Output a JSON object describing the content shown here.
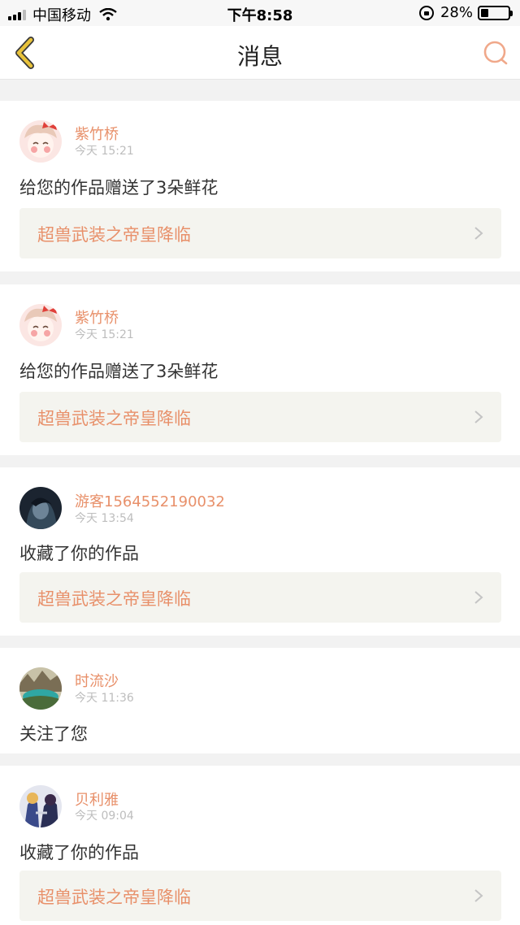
{
  "status_bar": {
    "carrier": "中国移动",
    "time": "下午8:58",
    "battery": "28%"
  },
  "header": {
    "title": "消息"
  },
  "messages": [
    {
      "user": "紫竹桥",
      "time": "今天 15:21",
      "text": "给您的作品赠送了3朵鲜花",
      "work": "超兽武装之帝皇降临"
    },
    {
      "user": "紫竹桥",
      "time": "今天 15:21",
      "text": "给您的作品赠送了3朵鲜花",
      "work": "超兽武装之帝皇降临"
    },
    {
      "user": "游客1564552190032",
      "time": "今天 13:54",
      "text": "收藏了你的作品",
      "work": "超兽武装之帝皇降临"
    },
    {
      "user": "时流沙",
      "time": "今天 11:36",
      "text": "关注了您"
    },
    {
      "user": "贝利雅",
      "time": "今天 09:04",
      "text": "收藏了你的作品",
      "work": "超兽武装之帝皇降临"
    }
  ],
  "colors": {
    "accent": "#e8906a",
    "back_icon": "#e8c23a",
    "card_link_bg": "#f4f4ef"
  }
}
